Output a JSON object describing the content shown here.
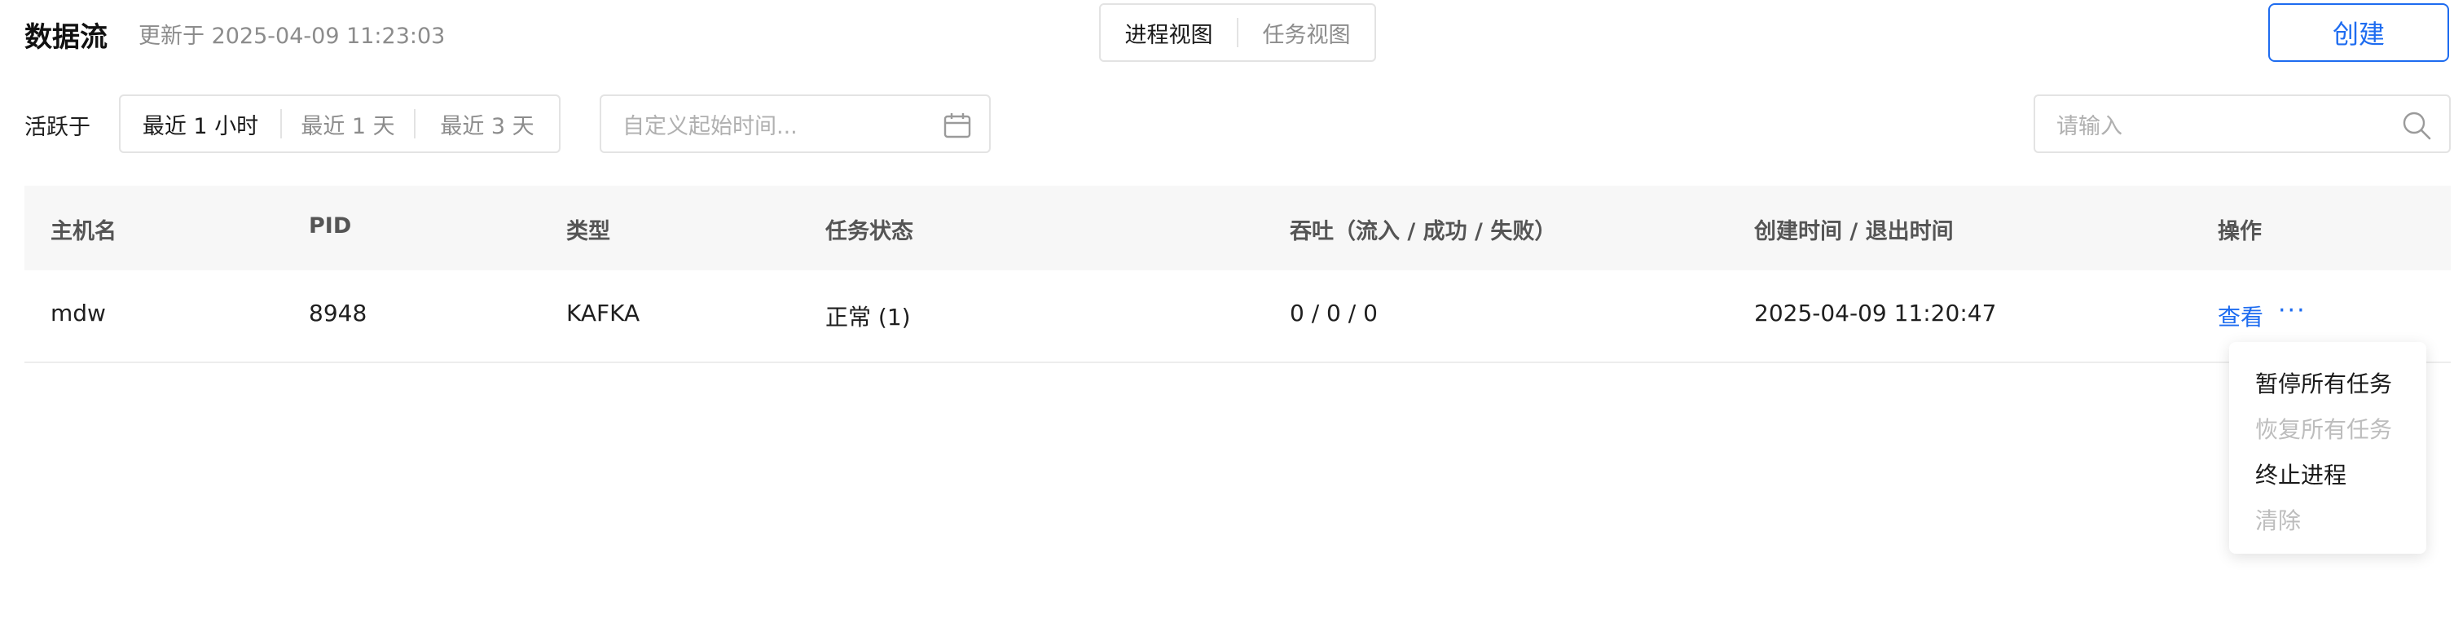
{
  "header": {
    "title": "数据流",
    "updated_text": "更新于 2025-04-09 11:23:03",
    "views": [
      "进程视图",
      "任务视图"
    ],
    "create_label": "创建"
  },
  "filters": {
    "active_label": "活跃于",
    "time_options": [
      "最近 1 小时",
      "最近 1 天",
      "最近 3 天"
    ],
    "date_placeholder": "自定义起始时间...",
    "search_placeholder": "请输入"
  },
  "table": {
    "columns": [
      "主机名",
      "PID",
      "类型",
      "任务状态",
      "吞吐（流入 / 成功 / 失败）",
      "创建时间 / 退出时间",
      "操作"
    ],
    "rows": [
      {
        "host": "mdw",
        "pid": "8948",
        "type": "KAFKA",
        "status": "正常 (1)",
        "throughput": "0 / 0 / 0",
        "time": "2025-04-09 11:20:47",
        "view_label": "查看",
        "more_label": "···"
      }
    ]
  },
  "menu": {
    "items": [
      "暂停所有任务",
      "恢复所有任务",
      "终止进程",
      "清除"
    ]
  },
  "colors": {
    "accent": "#1e6cf0",
    "muted": "#8c8c8c",
    "border": "#e3e3e3",
    "header_bg": "#f7f7f7"
  }
}
